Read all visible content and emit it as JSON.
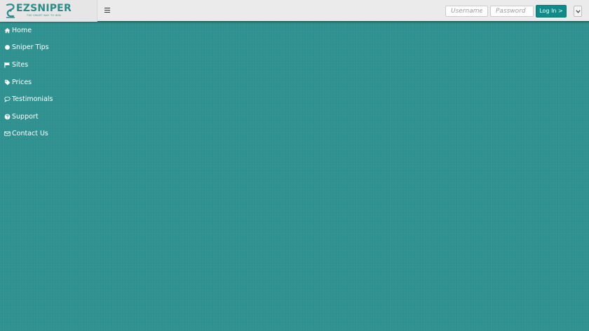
{
  "brand": {
    "name": "EZSNIPER",
    "tagline": "THE SMART WAY TO WIN",
    "color": "#2a8c8a"
  },
  "header": {
    "menu_icon": "hamburger-icon",
    "username_placeholder": "Username",
    "password_placeholder": "Password",
    "login_label": "Log In >",
    "dropdown_icon": "chevron-down-icon"
  },
  "sidebar": {
    "items": [
      {
        "label": "Home",
        "icon": "home-icon"
      },
      {
        "label": "Sniper Tips",
        "icon": "circle-icon"
      },
      {
        "label": "Sites",
        "icon": "flag-icon"
      },
      {
        "label": "Prices",
        "icon": "tag-icon"
      },
      {
        "label": "Testimonials",
        "icon": "comment-icon"
      },
      {
        "label": "Support",
        "icon": "question-icon"
      },
      {
        "label": "Contact Us",
        "icon": "envelope-icon"
      }
    ]
  },
  "colors": {
    "background": "#2f9290",
    "topbar": "#ebebeb",
    "accent": "#0f8c8a"
  }
}
